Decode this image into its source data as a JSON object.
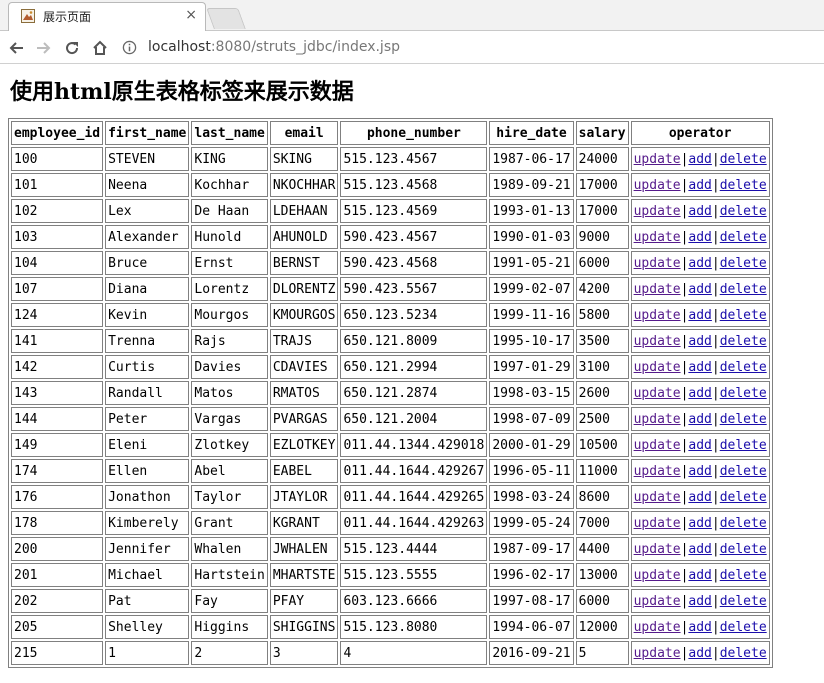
{
  "browser": {
    "tab_title": "展示页面",
    "tab_close": "×",
    "url_host": "localhost",
    "url_path": ":8080/struts_jdbc/index.jsp"
  },
  "icons": {
    "back": "back-arrow-icon",
    "forward": "forward-arrow-icon",
    "reload": "reload-icon",
    "home": "home-icon",
    "info": "info-icon"
  },
  "page": {
    "heading": "使用html原生表格标签来展示数据"
  },
  "table": {
    "headers": [
      "employee_id",
      "first_name",
      "last_name",
      "email",
      "phone_number",
      "hire_date",
      "salary",
      "operator"
    ],
    "actions": {
      "update": "update",
      "add": "add",
      "delete": "delete",
      "separator": "|"
    },
    "rows": [
      [
        "100",
        "STEVEN",
        "KING",
        "SKING",
        "515.123.4567",
        "1987-06-17",
        "24000"
      ],
      [
        "101",
        "Neena",
        "Kochhar",
        "NKOCHHAR",
        "515.123.4568",
        "1989-09-21",
        "17000"
      ],
      [
        "102",
        "Lex",
        "De Haan",
        "LDEHAAN",
        "515.123.4569",
        "1993-01-13",
        "17000"
      ],
      [
        "103",
        "Alexander",
        "Hunold",
        "AHUNOLD",
        "590.423.4567",
        "1990-01-03",
        "9000"
      ],
      [
        "104",
        "Bruce",
        "Ernst",
        "BERNST",
        "590.423.4568",
        "1991-05-21",
        "6000"
      ],
      [
        "107",
        "Diana",
        "Lorentz",
        "DLORENTZ",
        "590.423.5567",
        "1999-02-07",
        "4200"
      ],
      [
        "124",
        "Kevin",
        "Mourgos",
        "KMOURGOS",
        "650.123.5234",
        "1999-11-16",
        "5800"
      ],
      [
        "141",
        "Trenna",
        "Rajs",
        "TRAJS",
        "650.121.8009",
        "1995-10-17",
        "3500"
      ],
      [
        "142",
        "Curtis",
        "Davies",
        "CDAVIES",
        "650.121.2994",
        "1997-01-29",
        "3100"
      ],
      [
        "143",
        "Randall",
        "Matos",
        "RMATOS",
        "650.121.2874",
        "1998-03-15",
        "2600"
      ],
      [
        "144",
        "Peter",
        "Vargas",
        "PVARGAS",
        "650.121.2004",
        "1998-07-09",
        "2500"
      ],
      [
        "149",
        "Eleni",
        "Zlotkey",
        "EZLOTKEY",
        "011.44.1344.429018",
        "2000-01-29",
        "10500"
      ],
      [
        "174",
        "Ellen",
        "Abel",
        "EABEL",
        "011.44.1644.429267",
        "1996-05-11",
        "11000"
      ],
      [
        "176",
        "Jonathon",
        "Taylor",
        "JTAYLOR",
        "011.44.1644.429265",
        "1998-03-24",
        "8600"
      ],
      [
        "178",
        "Kimberely",
        "Grant",
        "KGRANT",
        "011.44.1644.429263",
        "1999-05-24",
        "7000"
      ],
      [
        "200",
        "Jennifer",
        "Whalen",
        "JWHALEN",
        "515.123.4444",
        "1987-09-17",
        "4400"
      ],
      [
        "201",
        "Michael",
        "Hartstein",
        "MHARTSTE",
        "515.123.5555",
        "1996-02-17",
        "13000"
      ],
      [
        "202",
        "Pat",
        "Fay",
        "PFAY",
        "603.123.6666",
        "1997-08-17",
        "6000"
      ],
      [
        "205",
        "Shelley",
        "Higgins",
        "SHIGGINS",
        "515.123.8080",
        "1994-06-07",
        "12000"
      ],
      [
        "215",
        "1",
        "2",
        "3",
        "4",
        "2016-09-21",
        "5"
      ]
    ]
  }
}
